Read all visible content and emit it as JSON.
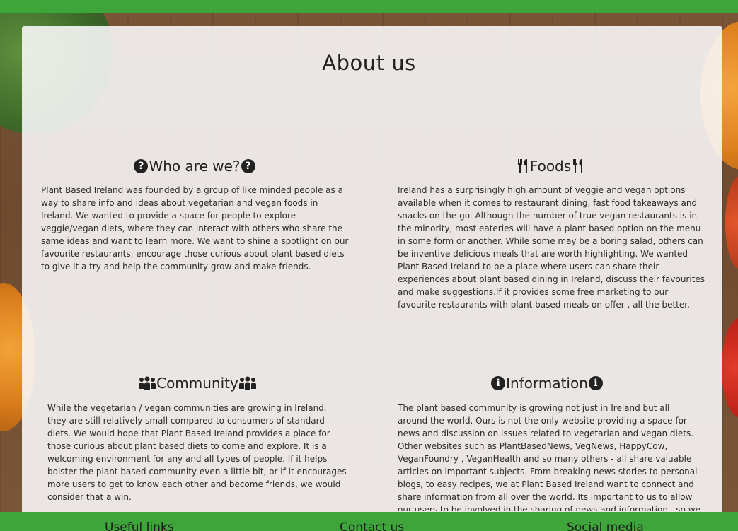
{
  "colors": {
    "green": "#3da53a",
    "card": "#f7f6f6",
    "text": "#222222"
  },
  "page_title": "About us",
  "sections": [
    {
      "title": "Who are we?",
      "icon": "question-circle-icon",
      "text": "Plant Based Ireland was founded by a group of like minded people as a way to share info and ideas about vegetarian and vegan foods in Ireland. We wanted to provide a space for people to explore veggie/vegan diets, where they can interact with others who share the same ideas and want to learn more. We want to shine a spotlight on our favourite restaurants, encourage those curious about plant based diets to give it a try and help the community grow and make friends."
    },
    {
      "title": "Foods",
      "icon": "utensils-icon",
      "text": "Ireland has a surprisingly high amount of veggie and vegan options available when it comes to restaurant dining, fast food takeaways and snacks on the go. Although the number of true vegan restaurants is in the minority, most eateries will have a plant based option on the menu in some form or another. While some may be a boring salad, others can be inventive delicious meals that are worth highlighting. We wanted Plant Based Ireland to be a place where users can share their experiences about plant based dining in Ireland, discuss their favourites and make suggestions.If it provides some free marketing to our favourite restaurants with plant based meals on offer , all the better."
    },
    {
      "title": "Community",
      "icon": "people-icon",
      "text": "While the vegetarian / vegan communities are growing in Ireland, they are still relatively small compared to consumers of standard diets. We would hope that Plant Based Ireland provides a place for those curious about plant based diets to come and explore. It is a welcoming environment for any and all types of people. If it helps bolster the plant based community even a little bit, or if it encourages more users to get to know each other and become friends, we would consider that a win."
    },
    {
      "title": "Information",
      "icon": "info-circle-icon",
      "text": "The plant based community is growing not just in Ireland but all around the world. Ours is not the only website providing a space for news and discussion on issues related to vegetarian and vegan diets. Other websites such as PlantBasedNews, VegNews, HappyCow, VeganFoundry , VeganHealth and so many others - all share valuable articles on important subjects. From breaking news stories to personal blogs, to easy recipes, we at Plant Based Ireland want to connect and share information from all over the world. Its important to us to allow our users to be involved in the sharing of news and information , so we have provided a platform for"
    }
  ],
  "footer": {
    "useful_links": "Useful links",
    "contact_us": "Contact us",
    "social_media": "Social media"
  }
}
